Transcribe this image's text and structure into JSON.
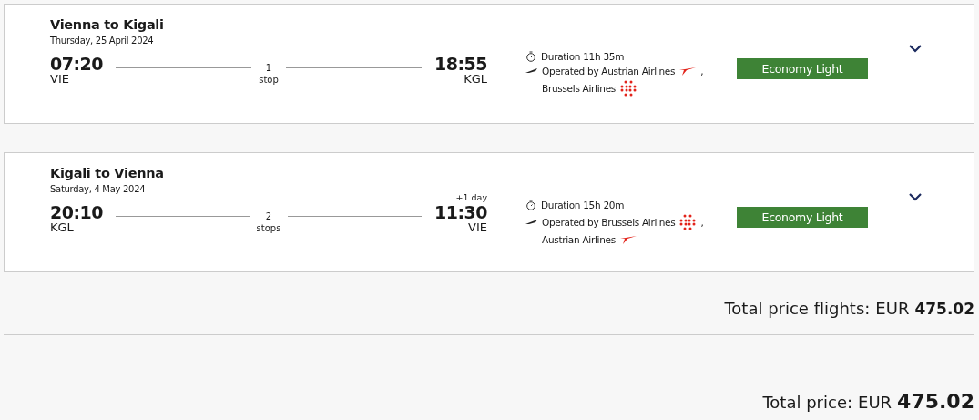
{
  "flights": [
    {
      "title": "Vienna to Kigali",
      "date": "Thursday, 25 April 2024",
      "departure": {
        "time": "07:20",
        "airport": "VIE"
      },
      "stops": {
        "count": "1",
        "label": "stop"
      },
      "arrival": {
        "time": "18:55",
        "airport": "KGL"
      },
      "duration": "Duration 11h 35m",
      "operated_by": "Operated by",
      "operators": [
        {
          "name": "Austrian Airlines",
          "kind": "austrian",
          "separator": ","
        },
        {
          "name": "Brussels Airlines",
          "kind": "brussels"
        }
      ],
      "fare": "Economy Light",
      "expanded": false
    },
    {
      "title": "Kigali to Vienna",
      "date": "Saturday, 4 May 2024",
      "departure": {
        "time": "20:10",
        "airport": "KGL"
      },
      "stops": {
        "count": "2",
        "label": "stops"
      },
      "arrival": {
        "time": "11:30",
        "airport": "VIE",
        "day_offset": "+1 day"
      },
      "duration": "Duration 15h 20m",
      "operated_by": "Operated by",
      "operators": [
        {
          "name": "Brussels Airlines",
          "kind": "brussels",
          "separator": ","
        },
        {
          "name": "Austrian Airlines",
          "kind": "austrian"
        }
      ],
      "fare": "Economy Light",
      "expanded": false
    }
  ],
  "subtotal": {
    "label": "Total price flights:",
    "currency": "EUR",
    "amount": "475.02"
  },
  "total": {
    "label": "Total price:",
    "currency": "EUR",
    "amount": "475.02"
  }
}
